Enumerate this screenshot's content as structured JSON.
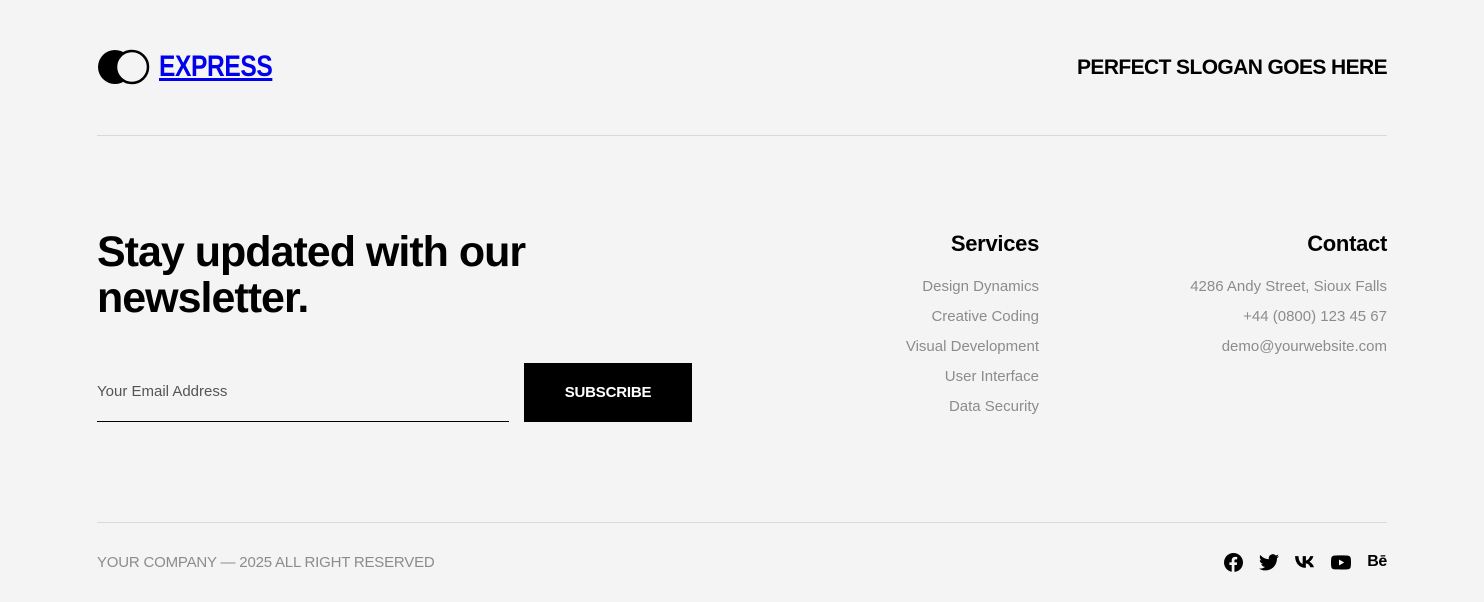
{
  "header": {
    "brand": "EXPRESS",
    "slogan": "PERFECT SLOGAN GOES HERE"
  },
  "newsletter": {
    "headline": "Stay updated with our newsletter.",
    "email_placeholder": "Your Email Address",
    "email_value": "",
    "subscribe_label": "SUBSCRIBE"
  },
  "services": {
    "title": "Services",
    "items": [
      {
        "label": "Design Dynamics"
      },
      {
        "label": "Creative Coding"
      },
      {
        "label": "Visual Development"
      },
      {
        "label": "User Interface"
      },
      {
        "label": "Data Security"
      }
    ]
  },
  "contact": {
    "title": "Contact",
    "address": "4286 Andy Street, Sioux Falls",
    "phone": "+44 (0800) 123 45 67",
    "email": "demo@yourwebsite.com"
  },
  "footer": {
    "copyright": "YOUR COMPANY — 2025 ALL RIGHT RESERVED",
    "social": [
      {
        "icon": "facebook-icon"
      },
      {
        "icon": "twitter-icon"
      },
      {
        "icon": "vk-icon"
      },
      {
        "icon": "youtube-icon"
      },
      {
        "icon": "behance-icon",
        "glyph": "Bē"
      }
    ]
  }
}
